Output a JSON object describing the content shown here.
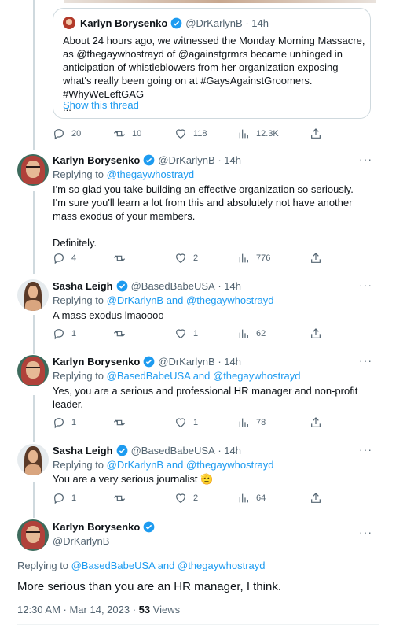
{
  "quoted": {
    "name": "Karlyn Borysenko",
    "handle": "@DrKarlynB",
    "time": "14h",
    "text": "About 24 hours ago, we witnessed the Monday Morning Massacre, as @thegaywhostrayd of @againstgrmrs became unhinged in anticipation of whistleblowers from her organization exposing what's really been going on at #GaysAgainstGroomers. #WhyWeLeftGAG",
    "ellipsis": "...",
    "show_thread": "Show this thread"
  },
  "quoted_actions": {
    "replies": "20",
    "retweets": "10",
    "likes": "118",
    "views": "12.3K"
  },
  "tweets": [
    {
      "name": "Karlyn Borysenko",
      "handle": "@DrKarlynB",
      "time": "· 14h",
      "reply_prefix": "Replying to ",
      "reply_to": "@thegaywhostrayd",
      "text": "I'm so glad you take building an effective organization so seriously. I'm sure you'll learn a lot from this and absolutely not have another mass exodus of your members.",
      "text2": "Definitely.",
      "replies": "4",
      "retweets": "",
      "likes": "2",
      "views": "776"
    },
    {
      "name": "Sasha Leigh",
      "handle": "@BasedBabeUSA",
      "time": "· 14h",
      "reply_prefix": "Replying to ",
      "reply_to": "@DrKarlynB and @thegaywhostrayd",
      "text": "A mass exodus lmaoooo",
      "replies": "1",
      "retweets": "",
      "likes": "1",
      "views": "62"
    },
    {
      "name": "Karlyn Borysenko",
      "handle": "@DrKarlynB",
      "time": "· 14h",
      "reply_prefix": "Replying to ",
      "reply_to": "@BasedBabeUSA and @thegaywhostrayd",
      "text": "Yes, you are a serious and professional HR manager and non-profit leader.",
      "replies": "1",
      "retweets": "",
      "likes": "1",
      "views": "78"
    },
    {
      "name": "Sasha Leigh",
      "handle": "@BasedBabeUSA",
      "time": "· 14h",
      "reply_prefix": "Replying to ",
      "reply_to": "@DrKarlynB and @thegaywhostrayd",
      "text": "You are a very serious journalist 🫡",
      "replies": "1",
      "retweets": "",
      "likes": "2",
      "views": "64"
    }
  ],
  "main": {
    "name": "Karlyn Borysenko",
    "handle": "@DrKarlynB",
    "reply_prefix": "Replying to ",
    "reply_to": "@BasedBabeUSA and @thegaywhostrayd",
    "text": "More serious than you are an HR manager, I think.",
    "timestamp": "12:30 AM · Mar 14, 2023 · ",
    "views_count": "53",
    "views_label": " Views"
  },
  "more_label": "···",
  "colors": {
    "link": "#1d9bf0",
    "muted": "#536471",
    "verified": "#1d9bf0"
  }
}
